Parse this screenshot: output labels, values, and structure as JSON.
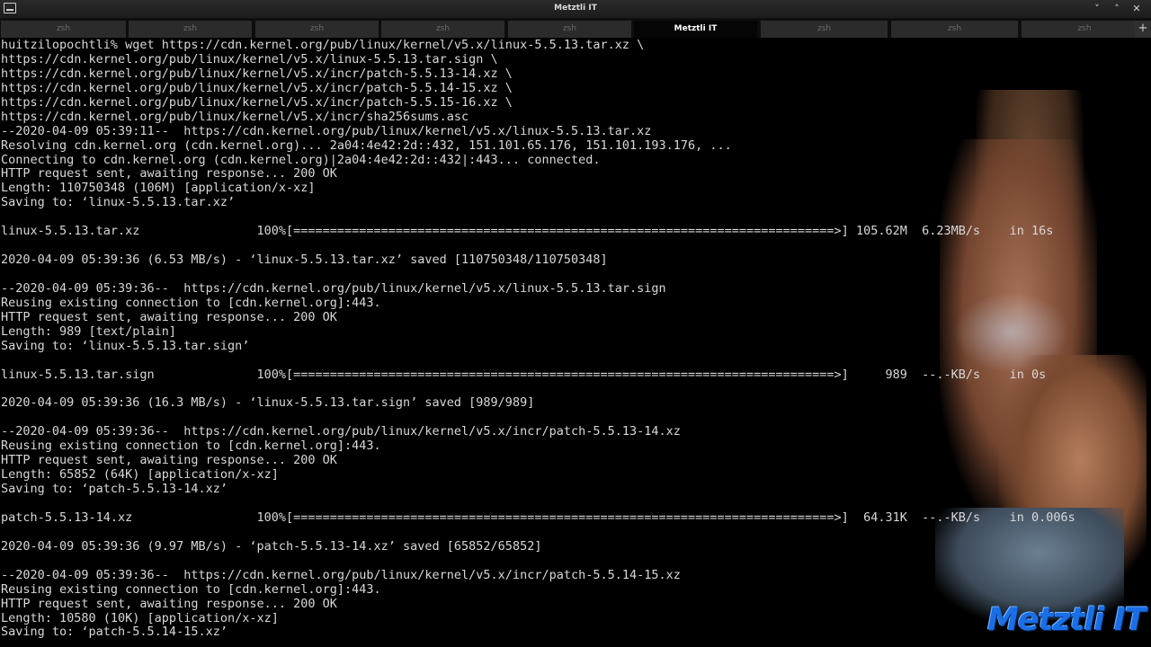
{
  "window": {
    "title": "Metztli IT",
    "controls": {
      "minimize": "˅",
      "maximize": "˄",
      "close": "✕"
    }
  },
  "tabs": [
    {
      "label": "zsh",
      "active": false
    },
    {
      "label": "zsh",
      "active": false
    },
    {
      "label": "zsh",
      "active": false
    },
    {
      "label": "zsh",
      "active": false
    },
    {
      "label": "zsh",
      "active": false
    },
    {
      "label": "Metztli IT",
      "active": true
    },
    {
      "label": "zsh",
      "active": false
    },
    {
      "label": "zsh",
      "active": false
    },
    {
      "label": "zsh",
      "active": false
    }
  ],
  "new_tab_label": "+",
  "terminal": {
    "lines": [
      "huitzilopochtli% wget https://cdn.kernel.org/pub/linux/kernel/v5.x/linux-5.5.13.tar.xz \\",
      "https://cdn.kernel.org/pub/linux/kernel/v5.x/linux-5.5.13.tar.sign \\",
      "https://cdn.kernel.org/pub/linux/kernel/v5.x/incr/patch-5.5.13-14.xz \\",
      "https://cdn.kernel.org/pub/linux/kernel/v5.x/incr/patch-5.5.14-15.xz \\",
      "https://cdn.kernel.org/pub/linux/kernel/v5.x/incr/patch-5.5.15-16.xz \\",
      "https://cdn.kernel.org/pub/linux/kernel/v5.x/incr/sha256sums.asc",
      "--2020-04-09 05:39:11--  https://cdn.kernel.org/pub/linux/kernel/v5.x/linux-5.5.13.tar.xz",
      "Resolving cdn.kernel.org (cdn.kernel.org)... 2a04:4e42:2d::432, 151.101.65.176, 151.101.193.176, ...",
      "Connecting to cdn.kernel.org (cdn.kernel.org)|2a04:4e42:2d::432|:443... connected.",
      "HTTP request sent, awaiting response... 200 OK",
      "Length: 110750348 (106M) [application/x-xz]",
      "Saving to: ‘linux-5.5.13.tar.xz’",
      "",
      "linux-5.5.13.tar.xz                100%[==========================================================================>] 105.62M  6.23MB/s    in 16s",
      "",
      "2020-04-09 05:39:36 (6.53 MB/s) - ‘linux-5.5.13.tar.xz’ saved [110750348/110750348]",
      "",
      "--2020-04-09 05:39:36--  https://cdn.kernel.org/pub/linux/kernel/v5.x/linux-5.5.13.tar.sign",
      "Reusing existing connection to [cdn.kernel.org]:443.",
      "HTTP request sent, awaiting response... 200 OK",
      "Length: 989 [text/plain]",
      "Saving to: ‘linux-5.5.13.tar.sign’",
      "",
      "linux-5.5.13.tar.sign              100%[==========================================================================>]     989  --.-KB/s    in 0s",
      "",
      "2020-04-09 05:39:36 (16.3 MB/s) - ‘linux-5.5.13.tar.sign’ saved [989/989]",
      "",
      "--2020-04-09 05:39:36--  https://cdn.kernel.org/pub/linux/kernel/v5.x/incr/patch-5.5.13-14.xz",
      "Reusing existing connection to [cdn.kernel.org]:443.",
      "HTTP request sent, awaiting response... 200 OK",
      "Length: 65852 (64K) [application/x-xz]",
      "Saving to: ‘patch-5.5.13-14.xz’",
      "",
      "patch-5.5.13-14.xz                 100%[==========================================================================>]  64.31K  --.-KB/s    in 0.006s",
      "",
      "2020-04-09 05:39:36 (9.97 MB/s) - ‘patch-5.5.13-14.xz’ saved [65852/65852]",
      "",
      "--2020-04-09 05:39:36--  https://cdn.kernel.org/pub/linux/kernel/v5.x/incr/patch-5.5.14-15.xz",
      "Reusing existing connection to [cdn.kernel.org]:443.",
      "HTTP request sent, awaiting response... 200 OK",
      "Length: 10580 (10K) [application/x-xz]",
      "Saving to: ‘patch-5.5.14-15.xz’"
    ]
  },
  "watermark": {
    "text": "Metztli IT",
    "color": "#1a6ee6"
  },
  "colors": {
    "background": "#000000",
    "foreground": "#d8d8d8",
    "active_tab": "#050505",
    "inactive_tab": "#2b2b2b"
  }
}
